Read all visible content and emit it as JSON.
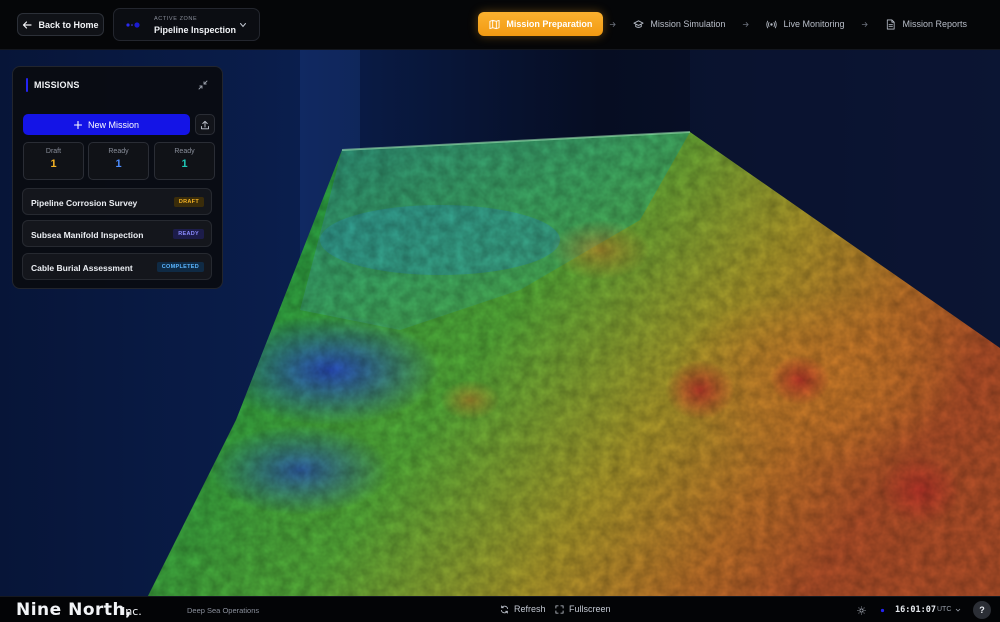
{
  "header": {
    "back_label": "Back to Home",
    "zone_caption": "ACTIVE ZONE",
    "zone_name": "Pipeline Inspection",
    "steps": [
      {
        "label": "Mission Preparation",
        "active": true,
        "icon": "map-icon"
      },
      {
        "label": "Mission Simulation",
        "active": false,
        "icon": "graduation-cap-icon"
      },
      {
        "label": "Live Monitoring",
        "active": false,
        "icon": "broadcast-icon"
      },
      {
        "label": "Mission Reports",
        "active": false,
        "icon": "document-icon"
      }
    ]
  },
  "missions_panel": {
    "title": "MISSIONS",
    "new_mission_label": "New Mission",
    "stats": [
      {
        "label": "Draft",
        "value": "1",
        "color": "#f5b324"
      },
      {
        "label": "Ready",
        "value": "1",
        "color": "#4d8dff"
      },
      {
        "label": "Ready",
        "value": "1",
        "color": "#1fc7b6"
      }
    ],
    "items": [
      {
        "name": "Pipeline Corrosion Survey",
        "status": "DRAFT",
        "color": "#f5b324",
        "bg": "#3a2c0a"
      },
      {
        "name": "Subsea Manifold Inspection",
        "status": "READY",
        "color": "#8b8bff",
        "bg": "#1c1c4a"
      },
      {
        "name": "Cable Burial Assessment",
        "status": "COMPLETED",
        "color": "#5cb6ff",
        "bg": "#0f2a44"
      }
    ]
  },
  "footer": {
    "brand": "Nine North,",
    "brand_suffix": "Inc.",
    "subtitle": "Deep Sea Operations",
    "refresh_label": "Refresh",
    "fullscreen_label": "Fullscreen",
    "time": "16:01:07",
    "timezone": "UTC",
    "help_label": "?"
  },
  "colors": {
    "accent": "#1414e6",
    "active_step": "#f7a51e"
  }
}
